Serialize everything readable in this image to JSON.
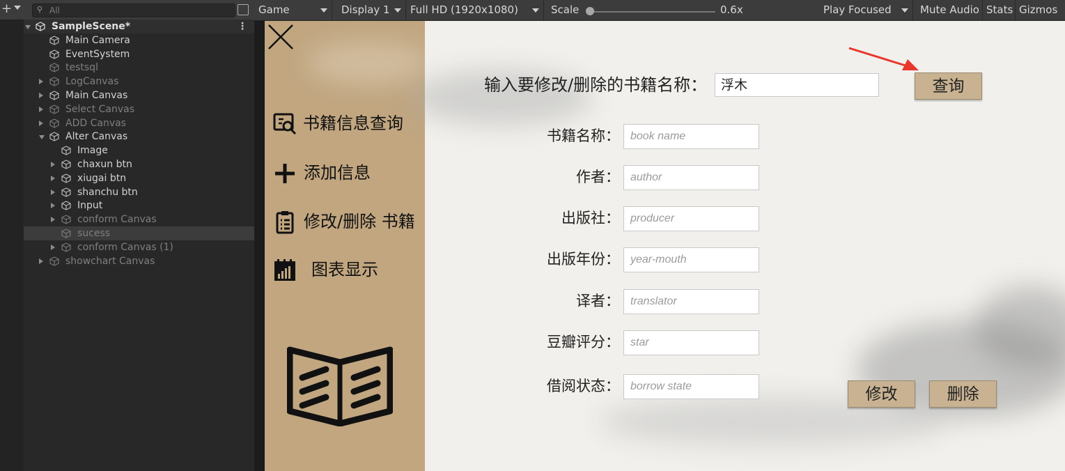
{
  "hierarchy": {
    "search_placeholder": "All",
    "rows": [
      {
        "label": "SampleScene*",
        "indent": 0,
        "expand": "down",
        "scene": true,
        "dim": false,
        "selected": false
      },
      {
        "label": "Main Camera",
        "indent": 1,
        "expand": "none",
        "dim": false,
        "selected": false
      },
      {
        "label": "EventSystem",
        "indent": 1,
        "expand": "none",
        "dim": false,
        "selected": false
      },
      {
        "label": "testsql",
        "indent": 1,
        "expand": "none",
        "dim": true,
        "selected": false
      },
      {
        "label": "LogCanvas",
        "indent": 1,
        "expand": "right",
        "dim": true,
        "selected": false
      },
      {
        "label": "Main Canvas",
        "indent": 1,
        "expand": "right",
        "dim": false,
        "selected": false
      },
      {
        "label": "Select Canvas",
        "indent": 1,
        "expand": "right",
        "dim": true,
        "selected": false
      },
      {
        "label": "ADD Canvas",
        "indent": 1,
        "expand": "right",
        "dim": true,
        "selected": false
      },
      {
        "label": "Alter Canvas",
        "indent": 1,
        "expand": "down",
        "dim": false,
        "selected": false
      },
      {
        "label": "Image",
        "indent": 2,
        "expand": "none",
        "dim": false,
        "selected": false
      },
      {
        "label": "chaxun btn",
        "indent": 2,
        "expand": "right",
        "dim": false,
        "selected": false
      },
      {
        "label": "xiugai btn",
        "indent": 2,
        "expand": "right",
        "dim": false,
        "selected": false
      },
      {
        "label": "shanchu btn",
        "indent": 2,
        "expand": "right",
        "dim": false,
        "selected": false
      },
      {
        "label": "Input",
        "indent": 2,
        "expand": "right",
        "dim": false,
        "selected": false
      },
      {
        "label": "conform Canvas",
        "indent": 2,
        "expand": "right",
        "dim": true,
        "selected": false
      },
      {
        "label": "sucess",
        "indent": 2,
        "expand": "none",
        "dim": true,
        "selected": true
      },
      {
        "label": "conform Canvas (1)",
        "indent": 2,
        "expand": "right",
        "dim": true,
        "selected": false
      },
      {
        "label": "showchart Canvas",
        "indent": 1,
        "expand": "right",
        "dim": true,
        "selected": false
      }
    ]
  },
  "game_toolbar": {
    "view": "Game",
    "display": "Display 1",
    "resolution": "Full HD (1920x1080)",
    "scale_label": "Scale",
    "scale_value": "0.6x",
    "play_focused": "Play Focused",
    "mute_audio": "Mute Audio",
    "stats": "Stats",
    "gizmos": "Gizmos"
  },
  "sidebar": {
    "items": [
      {
        "label": "书籍信息查询",
        "icon": "search-document-icon"
      },
      {
        "label": "添加信息",
        "icon": "plus-icon"
      },
      {
        "label": "修改/删除 书籍",
        "icon": "clipboard-icon"
      },
      {
        "label": "图表显示",
        "icon": "chart-calendar-icon"
      }
    ]
  },
  "query": {
    "label": "输入要修改/删除的书籍名称：",
    "value": "浮木",
    "button": "查询"
  },
  "form": {
    "fields": [
      {
        "label": "书籍名称：",
        "placeholder": "book name"
      },
      {
        "label": "作者：",
        "placeholder": "author"
      },
      {
        "label": "出版社：",
        "placeholder": "producer"
      },
      {
        "label": "出版年份：",
        "placeholder": "year-mouth"
      },
      {
        "label": "译者：",
        "placeholder": "translator"
      },
      {
        "label": "豆瓣评分：",
        "placeholder": "star"
      },
      {
        "label": "借阅状态：",
        "placeholder": "borrow state"
      }
    ],
    "modify_button": "修改",
    "delete_button": "删除"
  },
  "colors": {
    "sidebar": "#c1a680",
    "button": "#c8b291",
    "annotation_arrow": "#e8362c"
  }
}
